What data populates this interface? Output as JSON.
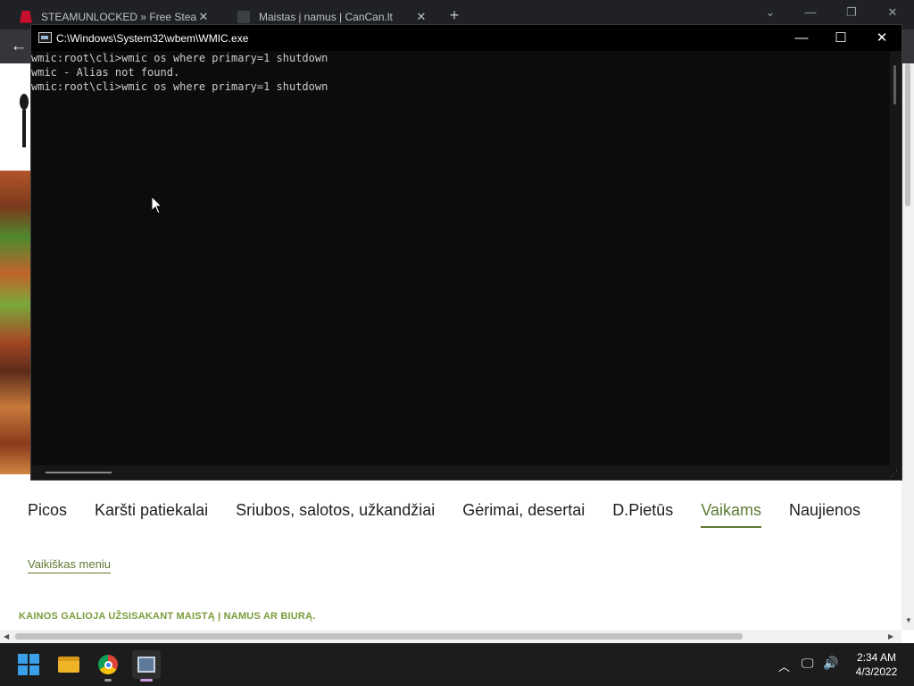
{
  "browser": {
    "tabs": [
      {
        "label": "STEAMUNLOCKED » Free Steam",
        "active": false
      },
      {
        "label": "Maistas į namus | CanCan.lt",
        "active": true
      }
    ],
    "new_tab_symbol": "+",
    "back_symbol": "←"
  },
  "page": {
    "categories": [
      "Picos",
      "Karšti patiekalai",
      "Sriubos, salotos, užkandžiai",
      "Gėrimai, desertai",
      "D.Pietūs",
      "Vaikams",
      "Naujienos"
    ],
    "active_category": "Vaikams",
    "submenu": "Vaikiškas meniu",
    "notice": "KAINOS GALIOJA UŽSISAKANT MAISTĄ Į NAMUS AR BIURĄ."
  },
  "console": {
    "title": "C:\\Windows\\System32\\wbem\\WMIC.exe",
    "lines": [
      "wmic:root\\cli>wmic os where primary=1 shutdown",
      "wmic - Alias not found.",
      "wmic:root\\cli>wmic os where primary=1 shutdown"
    ],
    "minimize_symbol": "—",
    "maximize_symbol": "☐",
    "close_symbol": "✕"
  },
  "taskbar": {
    "icons": [
      "windows-start-icon",
      "file-explorer-icon",
      "chrome-icon",
      "wmic-console-icon"
    ],
    "time": "2:34 AM",
    "date": "4/3/2022"
  },
  "colors": {
    "accent_green": "#5e7a34",
    "notice_green": "#7d9b3c",
    "console_bg": "#0c0c0c",
    "taskbar_bg": "#1c1c1c"
  }
}
